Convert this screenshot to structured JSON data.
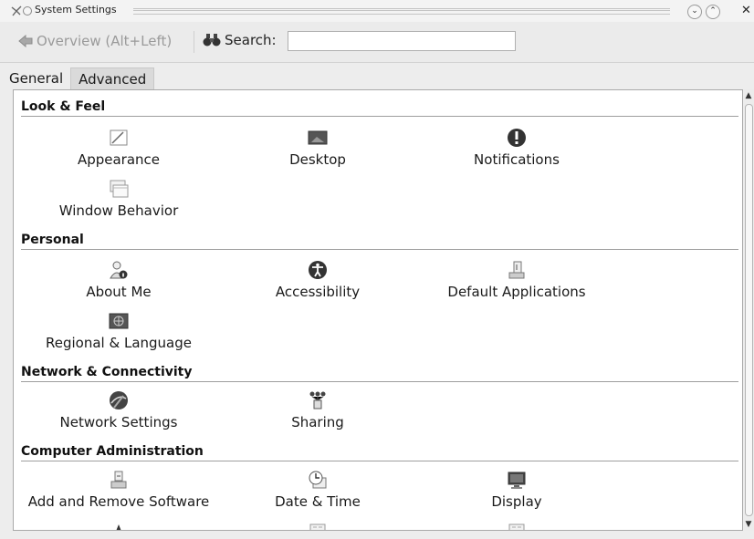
{
  "window": {
    "title": "System Settings"
  },
  "toolbar": {
    "back_label": "Overview (Alt+Left)",
    "search_label": "Search:",
    "search_value": ""
  },
  "tabs": [
    {
      "label": "General",
      "active": true
    },
    {
      "label": "Advanced",
      "active": false
    }
  ],
  "categories": [
    {
      "name": "Look & Feel",
      "items": [
        {
          "label": "Appearance",
          "icon": "appearance-icon"
        },
        {
          "label": "Desktop",
          "icon": "desktop-icon"
        },
        {
          "label": "Notifications",
          "icon": "notifications-icon"
        },
        {
          "label": "Window Behavior",
          "icon": "window-behavior-icon"
        }
      ]
    },
    {
      "name": "Personal",
      "items": [
        {
          "label": "About Me",
          "icon": "about-me-icon"
        },
        {
          "label": "Accessibility",
          "icon": "accessibility-icon"
        },
        {
          "label": "Default Applications",
          "icon": "default-applications-icon"
        },
        {
          "label": "Regional & Language",
          "icon": "regional-language-icon"
        }
      ]
    },
    {
      "name": "Network & Connectivity",
      "items": [
        {
          "label": "Network Settings",
          "icon": "network-settings-icon"
        },
        {
          "label": "Sharing",
          "icon": "sharing-icon"
        }
      ]
    },
    {
      "name": "Computer Administration",
      "items": [
        {
          "label": "Add and Remove Software",
          "icon": "software-icon"
        },
        {
          "label": "Date & Time",
          "icon": "date-time-icon"
        },
        {
          "label": "Display",
          "icon": "display-icon"
        }
      ]
    }
  ]
}
